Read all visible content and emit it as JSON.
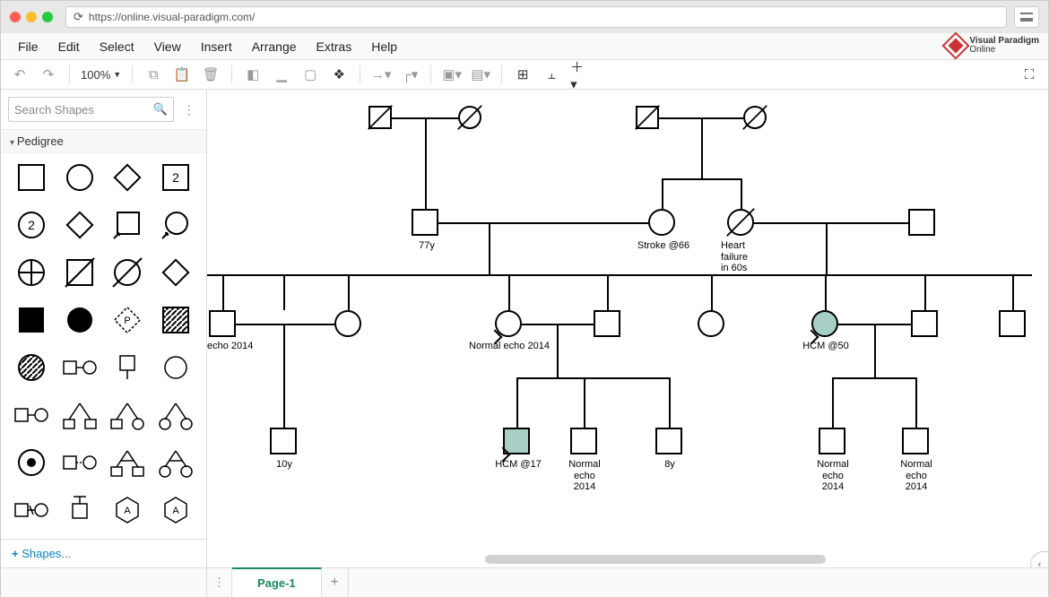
{
  "url": "https://online.visual-paradigm.com/",
  "brand": {
    "name1": "Visual Paradigm",
    "name2": "Online"
  },
  "menu": {
    "file": "File",
    "edit": "Edit",
    "select": "Select",
    "view": "View",
    "insert": "Insert",
    "arrange": "Arrange",
    "extras": "Extras",
    "help": "Help"
  },
  "toolbar": {
    "zoom": "100%"
  },
  "sidebar": {
    "search_placeholder": "Search Shapes",
    "category": "Pedigree",
    "shapes_label": "Shapes...",
    "cell_2a": "2",
    "cell_2b": "2"
  },
  "page_tab": "Page-1",
  "canvas": {
    "l_77y": "77y",
    "l_stroke66": "Stroke @66",
    "l_heartfail": "Heart\nfailure\nin 60s",
    "l_echo14_left": "echo 2014",
    "l_normal_echo_mid": "Normal echo 2014",
    "l_hcm50": "HCM @50",
    "l_10y": "10y",
    "l_hcm17": "HCM @17",
    "l_normal_echo_b1": "Normal\necho\n2014",
    "l_8y": "8y",
    "l_normal_echo_r1": "Normal\necho\n2014",
    "l_normal_echo_r2": "Normal\necho\n2014"
  }
}
